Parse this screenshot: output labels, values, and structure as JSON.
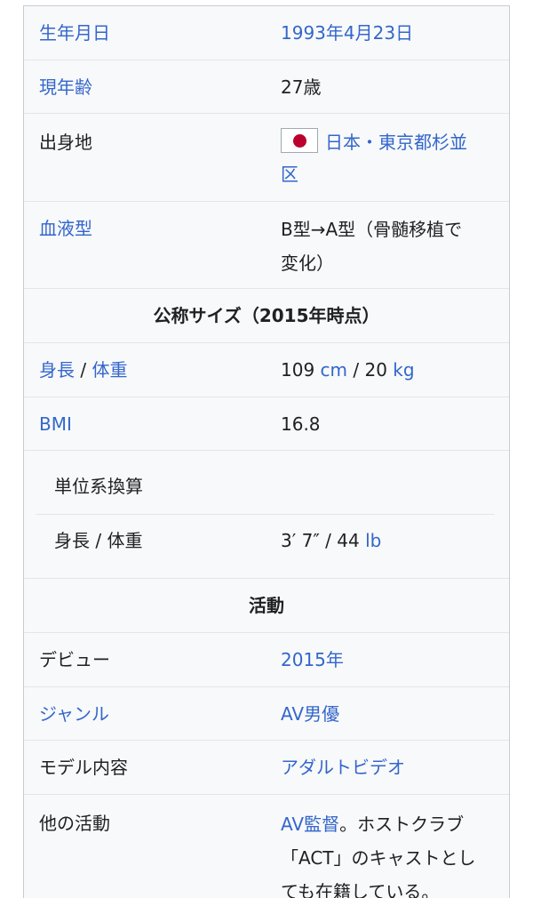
{
  "colors": {
    "link": "#3366cc",
    "text": "#202122",
    "background": "#f8f9fa",
    "border": "#c8ccd1",
    "flag_red": "#bc002d"
  },
  "rows": {
    "birthdate": {
      "label": "生年月日",
      "value": "1993年4月23日"
    },
    "age": {
      "label": "現年齢",
      "value": "27歳"
    },
    "birthplace": {
      "label": "出身地",
      "flag_icon": "japan-flag-icon",
      "value_line1": "日本・東京都杉並",
      "value_line2": "区"
    },
    "blood_type": {
      "label": "血液型",
      "value_line1": "B型→A型（骨髄移植で",
      "value_line2": "変化）"
    },
    "size_header": "公称サイズ（2015年時点）",
    "height_weight": {
      "label_a": "身長",
      "label_sep": " / ",
      "label_b": "体重",
      "value_num1": "109 ",
      "value_unit1": "cm",
      "value_sep": " / 20 ",
      "value_unit2": "kg"
    },
    "bmi": {
      "label": "BMI",
      "value": "16.8"
    },
    "unit_conversion": {
      "label": "単位系換算"
    },
    "imperial": {
      "label": "身長 / 体重",
      "value_num": "3′ 7″ / 44 ",
      "value_unit": "lb"
    },
    "activity_header": "活動",
    "debut": {
      "label": "デビュー",
      "value": "2015年"
    },
    "genre": {
      "label": "ジャンル",
      "value": "AV男優"
    },
    "model_content": {
      "label": "モデル内容",
      "value": "アダルトビデオ"
    },
    "other_activity": {
      "label": "他の活動",
      "value_link": "AV監督",
      "value_line1_rest": "。ホストクラブ",
      "value_line2": "「ACT」のキャストとし",
      "value_line3": "ても在籍している。"
    }
  }
}
